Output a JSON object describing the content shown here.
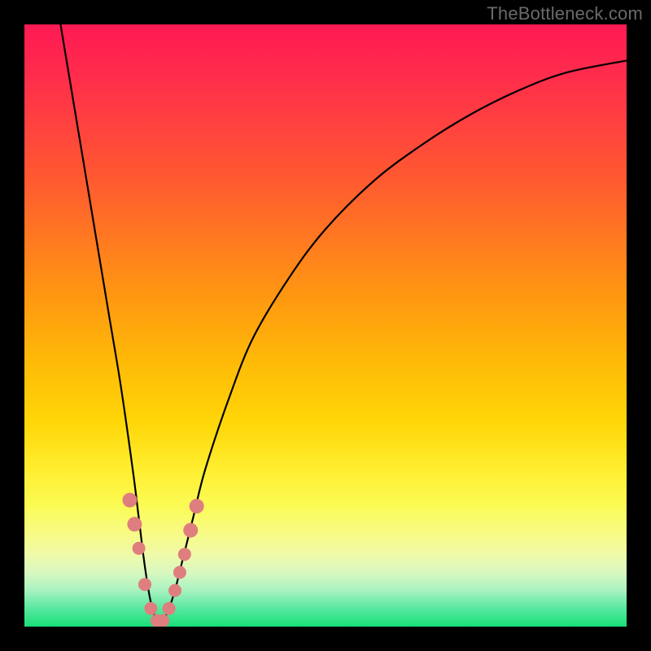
{
  "watermark": "TheBottleneck.com",
  "colors": {
    "frame": "#000000",
    "curve": "#000000",
    "bead": "#df7e7e",
    "watermark": "#6a6a6a"
  },
  "chart_data": {
    "type": "line",
    "title": "",
    "xlabel": "",
    "ylabel": "",
    "xlim": [
      0,
      100
    ],
    "ylim": [
      0,
      100
    ],
    "grid": false,
    "legend": false,
    "note": "V-shaped bottleneck curve; y≈0 is optimal (green), y≈100 is worst (red). Minimum near x≈22. No axis ticks or numeric labels visible.",
    "series": [
      {
        "name": "bottleneck-curve",
        "x": [
          6,
          8,
          10,
          12,
          14,
          16,
          18,
          19,
          20,
          21,
          22,
          23,
          24,
          25,
          26,
          28,
          30,
          34,
          38,
          44,
          50,
          58,
          66,
          74,
          82,
          90,
          100
        ],
        "y": [
          100,
          88,
          76,
          64,
          52,
          40,
          26,
          18,
          10,
          4,
          1,
          1,
          3,
          6,
          10,
          18,
          26,
          38,
          48,
          58,
          66,
          74,
          80,
          85,
          89,
          92,
          94
        ]
      }
    ],
    "markers": {
      "name": "highlight-beads",
      "x": [
        17.5,
        18.3,
        19.0,
        20.0,
        21.0,
        22.0,
        23.0,
        24.0,
        25.0,
        25.8,
        26.6,
        27.6,
        28.6
      ],
      "y": [
        21,
        17,
        13,
        7,
        3,
        1,
        1,
        3,
        6,
        9,
        12,
        16,
        20
      ],
      "r": [
        9,
        9,
        8,
        8,
        8,
        8,
        8,
        8,
        8,
        8,
        8,
        9,
        9
      ]
    }
  }
}
